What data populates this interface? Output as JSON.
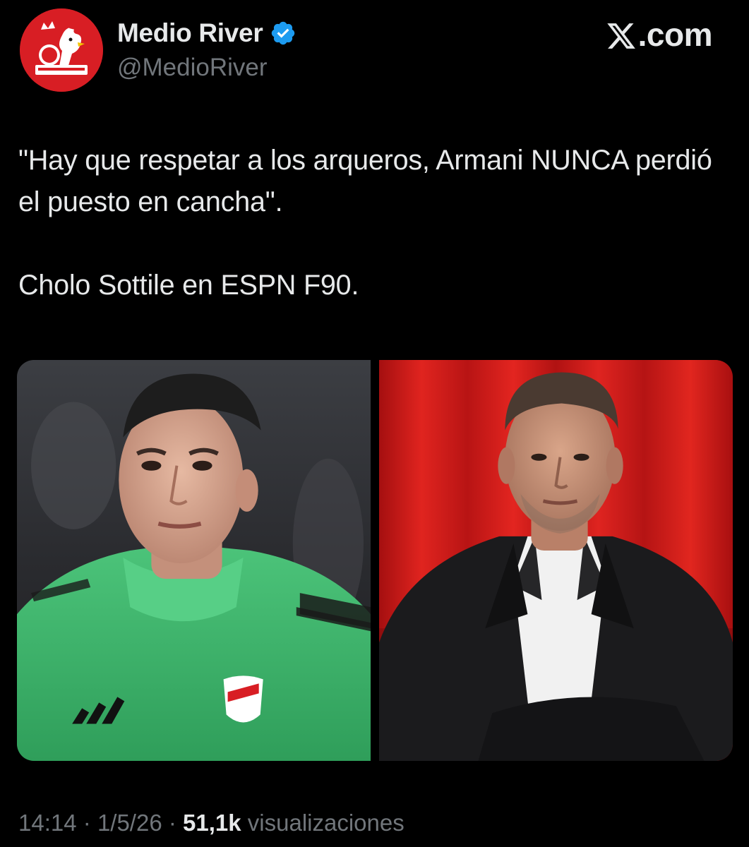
{
  "author": {
    "display_name": "Medio River",
    "handle": "@MedioRiver",
    "verified": true,
    "avatar_icon": "river-rooster-logo-icon",
    "avatar_color": "#d81e24"
  },
  "brand": {
    "text": ".com",
    "icon": "x-logo-icon"
  },
  "tweet": {
    "lines": [
      "\"Hay que respetar a los arqueros, Armani NUNCA perdió el puesto en cancha\".",
      "Cholo Sottile en ESPN F90."
    ]
  },
  "media": {
    "images": [
      {
        "name": "goalkeeper-photo",
        "jersey_color": "#3fb36a"
      },
      {
        "name": "commentator-photo",
        "background_color": "#c41616"
      }
    ]
  },
  "meta": {
    "time": "14:14",
    "separator_1": "·",
    "date": "1/5/26",
    "separator_2": "·",
    "views_count": "51,1k",
    "views_label": "visualizaciones"
  },
  "colors": {
    "background": "#000000",
    "primary_text": "#e7e9ea",
    "secondary_text": "#71767b",
    "verified_blue": "#1d9bf0"
  }
}
